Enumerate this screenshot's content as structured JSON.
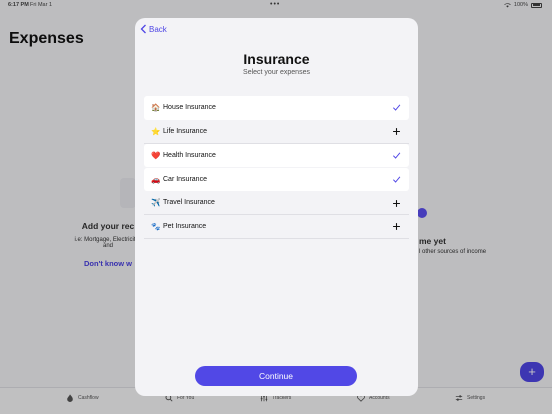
{
  "status_bar": {
    "time": "6:17 PM",
    "date": "Fri Mar 1",
    "dots": "•••",
    "battery": "100%"
  },
  "background": {
    "title": "Expenses",
    "left_heading": "Add your rec",
    "left_body": "i.e: Mortgage, Electricity l",
    "left_body_2": "and",
    "left_link": "Don't know w",
    "right_heading": "me yet",
    "right_body": "l other sources of income",
    "fab_label": "+"
  },
  "tabs": [
    {
      "label": "Cashflow",
      "icon": "flame-icon"
    },
    {
      "label": "For You",
      "icon": "search-icon"
    },
    {
      "label": "Trackers",
      "icon": "sliders-icon"
    },
    {
      "label": "Accounts",
      "icon": "heart-icon"
    },
    {
      "label": "Settings",
      "icon": "toggle-icon"
    }
  ],
  "sheet": {
    "back_label": "Back",
    "title": "Insurance",
    "subtitle": "Select your expenses",
    "continue_label": "Continue",
    "accent": "#5148e6",
    "items": [
      {
        "emoji": "🏠",
        "label": "House Insurance",
        "selected": true
      },
      {
        "emoji": "⭐",
        "label": "Life Insurance",
        "selected": false
      },
      {
        "emoji": "❤️",
        "label": "Health Insurance",
        "selected": true
      },
      {
        "emoji": "🚗",
        "label": "Car Insurance",
        "selected": true
      },
      {
        "emoji": "✈️",
        "label": "Travel Insurance",
        "selected": false
      },
      {
        "emoji": "🐾",
        "label": "Pet Insurance",
        "selected": false
      }
    ]
  }
}
